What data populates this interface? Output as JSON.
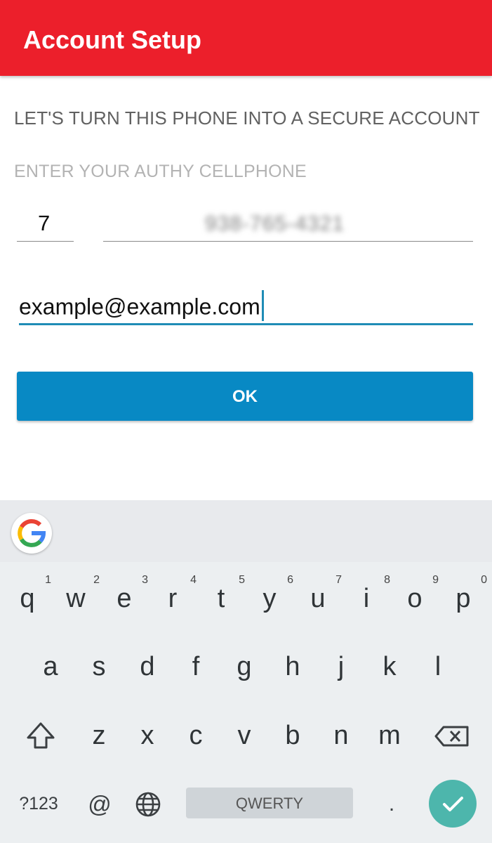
{
  "app": {
    "title": "Account Setup"
  },
  "form": {
    "heading": "LET'S TURN THIS PHONE INTO A SECURE ACCOUNT",
    "subheading": "ENTER YOUR AUTHY CELLPHONE",
    "country_code": "7",
    "phone_number": "938-765-4321",
    "email": "example@example.com",
    "ok_label": "OK"
  },
  "keyboard": {
    "row1": [
      {
        "k": "q",
        "h": "1"
      },
      {
        "k": "w",
        "h": "2"
      },
      {
        "k": "e",
        "h": "3"
      },
      {
        "k": "r",
        "h": "4"
      },
      {
        "k": "t",
        "h": "5"
      },
      {
        "k": "y",
        "h": "6"
      },
      {
        "k": "u",
        "h": "7"
      },
      {
        "k": "i",
        "h": "8"
      },
      {
        "k": "o",
        "h": "9"
      },
      {
        "k": "p",
        "h": "0"
      }
    ],
    "row2": [
      "a",
      "s",
      "d",
      "f",
      "g",
      "h",
      "j",
      "k",
      "l"
    ],
    "row3": [
      "z",
      "x",
      "c",
      "v",
      "b",
      "n",
      "m"
    ],
    "symbols_label": "?123",
    "at_label": "@",
    "space_label": "QWERTY",
    "period_label": "."
  },
  "colors": {
    "app_bar": "#ec1f2b",
    "accent": "#1f8cb6",
    "ok_button": "#0889c4",
    "enter_key": "#4db6ac"
  },
  "icons": [
    "google-icon",
    "shift-icon",
    "backspace-icon",
    "globe-icon",
    "check-icon"
  ]
}
